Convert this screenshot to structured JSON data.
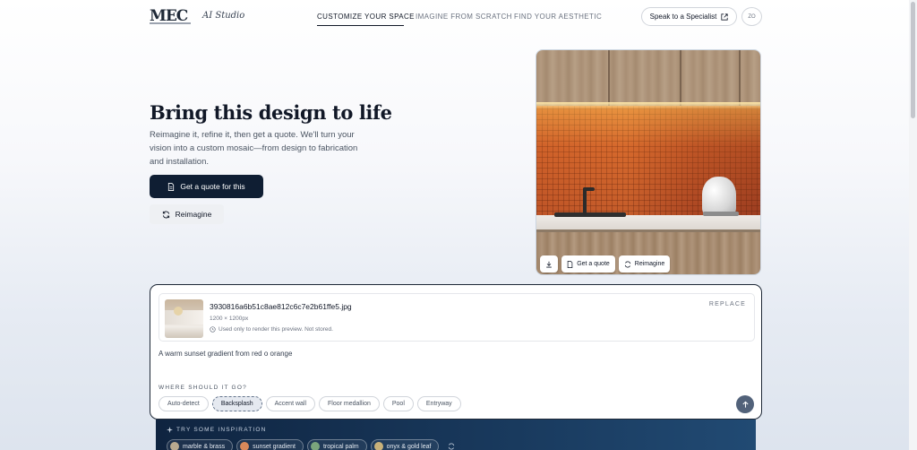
{
  "header": {
    "logo": "MEC",
    "brand_sub": "AI Studio",
    "nav": [
      {
        "label": "CUSTOMIZE YOUR SPACE",
        "active": true
      },
      {
        "label": "IMAGINE FROM SCRATCH",
        "active": false
      },
      {
        "label": "FIND YOUR AESTHETIC",
        "active": false
      }
    ],
    "specialist_label": "Speak to a Specialist",
    "avatar_initials": "ZO"
  },
  "hero": {
    "title": "Bring this design to life",
    "description": "Reimagine it, refine it, then get a quote. We'll turn your vision into a custom mosaic—from design to fabrication and installation.",
    "quote_label": "Get a quote for this",
    "reimagine_label": "Reimagine"
  },
  "preview": {
    "download_icon": "download-icon",
    "quote_label": "Get a quote",
    "reimagine_label": "Reimagine"
  },
  "upload": {
    "file_name": "3930816a6b51c8ae812c6c7e2b61ffe5.jpg",
    "dimensions": "1200 × 1200px",
    "note": "Used only to render this preview. Not stored.",
    "replace_label": "REPLACE",
    "prompt": "A warm sunset gradient from red o orange",
    "where_label": "WHERE SHOULD IT GO?",
    "placements": [
      {
        "label": "Auto-detect",
        "selected": false
      },
      {
        "label": "Backsplash",
        "selected": true
      },
      {
        "label": "Accent wall",
        "selected": false
      },
      {
        "label": "Floor medallion",
        "selected": false
      },
      {
        "label": "Pool",
        "selected": false
      },
      {
        "label": "Entryway",
        "selected": false
      }
    ]
  },
  "inspiration": {
    "label": "TRY SOME INSPIRATION",
    "items": [
      "marble & brass",
      "sunset gradient",
      "tropical palm",
      "onyx & gold leaf"
    ]
  },
  "colors": {
    "primary": "#0f1e33",
    "send": "#52627a",
    "inspiration_bg": "#193a5e"
  }
}
